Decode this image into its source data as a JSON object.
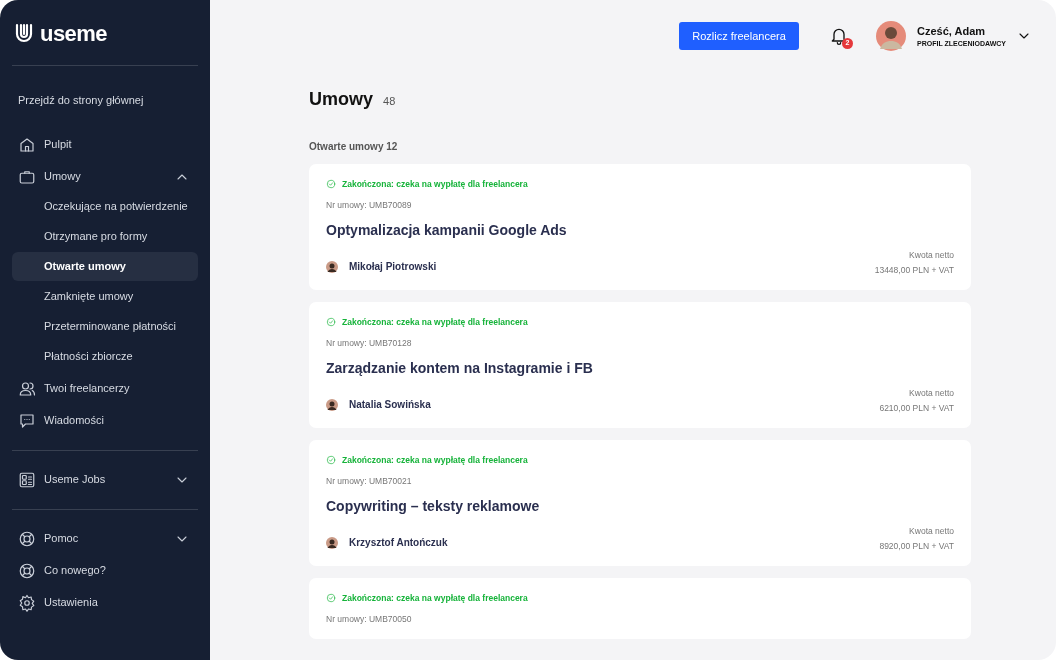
{
  "sidebar": {
    "logo": "useme",
    "home_link": "Przejdź do strony głównej",
    "sections": [
      [
        {
          "label": "Pulpit",
          "selected": false
        },
        {
          "label": "Umowy",
          "selected": false,
          "expanded": true,
          "children": [
            {
              "label": "Oczekujące na potwierdzenie",
              "selected": false
            },
            {
              "label": "Otrzymane pro formy",
              "selected": false
            },
            {
              "label": "Otwarte umowy",
              "selected": true
            },
            {
              "label": "Zamknięte umowy",
              "selected": false
            },
            {
              "label": "Przeterminowane płatności",
              "selected": false
            },
            {
              "label": "Płatności zbiorcze",
              "selected": false
            }
          ]
        },
        {
          "label": "Twoi freelancerzy",
          "selected": false
        },
        {
          "label": "Wiadomości",
          "selected": false
        }
      ],
      [
        {
          "label": "Useme Jobs",
          "selected": false,
          "expanded": false
        }
      ],
      [
        {
          "label": "Pomoc",
          "selected": false,
          "expanded": false
        },
        {
          "label": "Co nowego?",
          "selected": false
        },
        {
          "label": "Ustawienia",
          "selected": false
        }
      ]
    ]
  },
  "header": {
    "button": "Rozlicz freelancera",
    "notifications": "2",
    "greeting": "Cześć, Adam",
    "profile": "PROFIL ZLECENIODAWCY"
  },
  "page": {
    "title": "Umowy",
    "count": "48",
    "section": "Otwarte umowy 12"
  },
  "contracts": [
    {
      "status": "Zakończona: czeka na wypłatę dla freelancera",
      "number": "Nr umowy: UMB70089",
      "title": "Optymalizacja kampanii Google Ads",
      "freelancer": "Mikołaj Piotrowski",
      "amount_label": "Kwota netto",
      "amount": "13448,00 PLN + VAT"
    },
    {
      "status": "Zakończona: czeka na wypłatę dla freelancera",
      "number": "Nr umowy: UMB70128",
      "title": "Zarządzanie kontem na Instagramie i FB",
      "freelancer": "Natalia Sowińska",
      "amount_label": "Kwota netto",
      "amount": "6210,00 PLN + VAT"
    },
    {
      "status": "Zakończona: czeka na wypłatę dla freelancera",
      "number": "Nr umowy: UMB70021",
      "title": "Copywriting – teksty reklamowe",
      "freelancer": "Krzysztof Antończuk",
      "amount_label": "Kwota netto",
      "amount": "8920,00 PLN + VAT"
    },
    {
      "status": "Zakończona: czeka na wypłatę dla freelancera",
      "number": "Nr umowy: UMB70050"
    }
  ]
}
